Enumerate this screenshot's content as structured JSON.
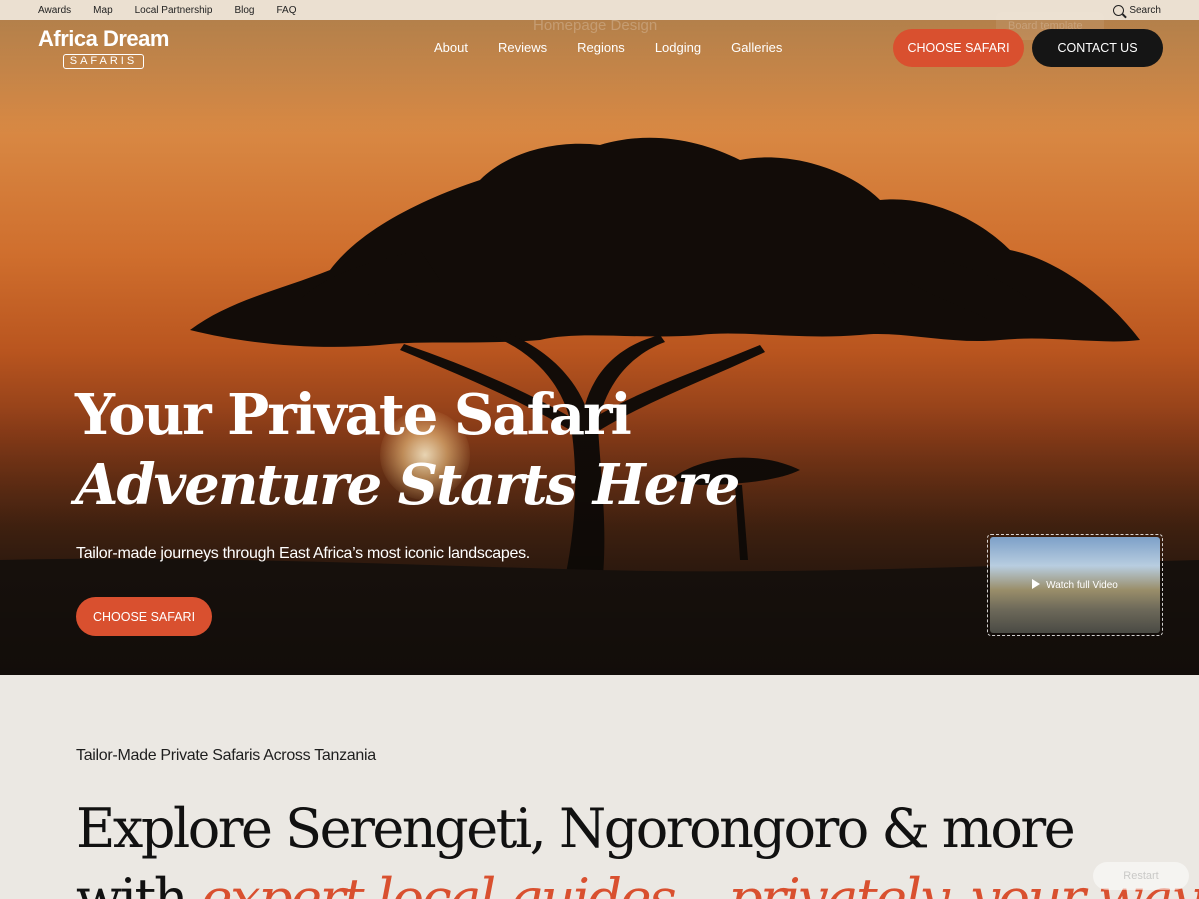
{
  "utility_bar": {
    "links": [
      "Awards",
      "Map",
      "Local Partnership",
      "Blog",
      "FAQ"
    ],
    "search_label": "Search"
  },
  "editor_overlay": {
    "title": "Homepage Design",
    "field_placeholder": "Board template",
    "restart_label": "Restart"
  },
  "logo": {
    "top": "Africa Dream",
    "bottom": "SAFARIS"
  },
  "nav": {
    "items": [
      "About",
      "Reviews",
      "Regions",
      "Lodging",
      "Galleries"
    ]
  },
  "header_buttons": {
    "choose": "CHOOSE SAFARI",
    "contact": "CONTACT US"
  },
  "hero": {
    "title_line1": "Your Private Safari",
    "title_line2": "Adventure Starts Here",
    "subtitle": "Tailor-made journeys through East Africa’s most iconic landscapes.",
    "cta": "CHOOSE SAFARI",
    "video_label": "Watch full Video"
  },
  "intro": {
    "eyebrow": "Tailor-Made Private Safaris Across Tanzania",
    "heading_line1": "Explore Serengeti, Ngorongoro & more",
    "heading_line2_prefix": "with ",
    "heading_line2_accent": "expert local guides – privately, your way"
  },
  "colors": {
    "accent": "#d9502f",
    "dark_button": "#151515",
    "section_bg": "#ebe8e3"
  }
}
